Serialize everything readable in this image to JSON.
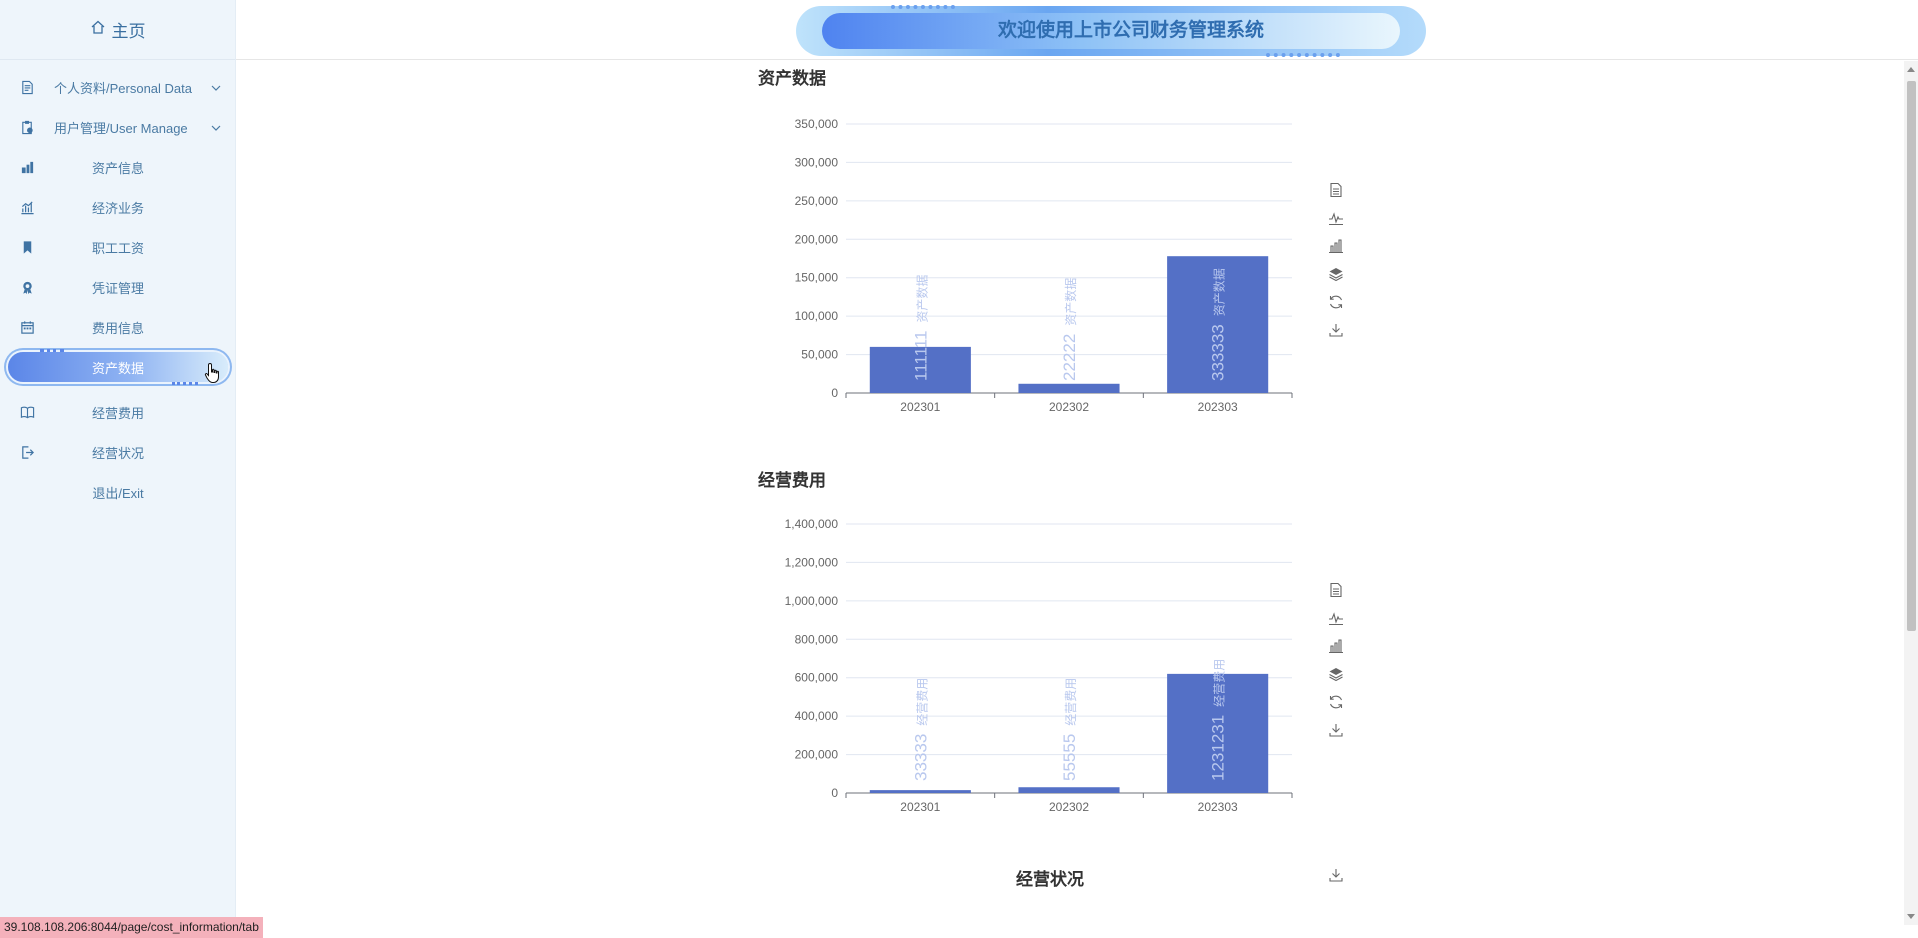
{
  "sidebar": {
    "home_label": "主页",
    "items": [
      {
        "label": "个人资料/Personal Data",
        "icon": "document-icon",
        "expandable": true
      },
      {
        "label": "用户管理/User Manage",
        "icon": "clipboard-user-icon",
        "expandable": true
      },
      {
        "label": "资产信息",
        "icon": "assets-icon"
      },
      {
        "label": "经济业务",
        "icon": "bar-chart-icon"
      },
      {
        "label": "职工工资",
        "icon": "bookmark-icon"
      },
      {
        "label": "凭证管理",
        "icon": "certificate-icon"
      },
      {
        "label": "费用信息",
        "icon": "calendar-icon"
      },
      {
        "label": "资产数据",
        "icon": "",
        "active": true
      },
      {
        "label": "经营费用",
        "icon": "book-icon"
      },
      {
        "label": "经营状况",
        "icon": "logout-icon"
      },
      {
        "label": "退出/Exit",
        "icon": ""
      }
    ]
  },
  "header": {
    "title": "欢迎使用上市公司财务管理系统"
  },
  "colors": {
    "bar": "#5470c6",
    "bar_label": "#b9c8ee",
    "accent": "#5b86e8"
  },
  "toolbox": [
    "data-view-icon",
    "line-chart-icon",
    "bar-chart-icon",
    "stack-icon",
    "restore-icon",
    "download-icon"
  ],
  "chart_data": [
    {
      "type": "bar",
      "title": "资产数据",
      "categories": [
        "202301",
        "202302",
        "202303"
      ],
      "values": [
        60000,
        12000,
        178000
      ],
      "bar_labels": [
        "111111",
        "22222",
        "333333"
      ],
      "bar_sublabels": [
        "资产数据",
        "资产数据",
        "资产数据"
      ],
      "ylim": [
        0,
        350000
      ],
      "yticks": [
        "0",
        "50,000",
        "100,000",
        "150,000",
        "200,000",
        "250,000",
        "300,000",
        "350,000"
      ],
      "grid": true
    },
    {
      "type": "bar",
      "title": "经营费用",
      "categories": [
        "202301",
        "202302",
        "202303"
      ],
      "values": [
        15000,
        30000,
        620000
      ],
      "bar_labels": [
        "33333",
        "55555",
        "1231231"
      ],
      "bar_sublabels": [
        "经营费用",
        "经营费用",
        "经营费用"
      ],
      "ylim": [
        0,
        1400000
      ],
      "yticks": [
        "0",
        "200,000",
        "400,000",
        "600,000",
        "800,000",
        "1,000,000",
        "1,200,000",
        "1,400,000"
      ],
      "grid": true
    }
  ],
  "third_chart_title": "经营状况",
  "statusbar": {
    "url": "39.108.108.206:8044/page/cost_information/tab"
  }
}
